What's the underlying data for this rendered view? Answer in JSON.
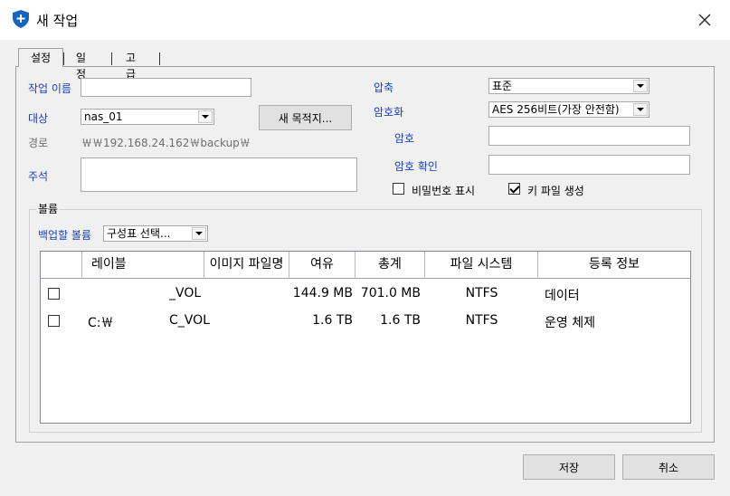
{
  "window": {
    "title": "새 작업"
  },
  "tabs": [
    "설정",
    "일정",
    "고급"
  ],
  "settings": {
    "job_name_label": "작업 이름",
    "job_name_value": "",
    "target_label": "대상",
    "target_value": "nas_01",
    "new_destination_label": "새 목적지...",
    "path_label": "경로",
    "path_value": "￦￦192.168.24.162￦backup￦",
    "comment_label": "주석",
    "comment_value": "",
    "compression_label": "압축",
    "compression_value": "표준",
    "encryption_label": "암호화",
    "encryption_value": "AES 256비트(가장 안전함)",
    "password_label": "암호",
    "password_value": "",
    "confirm_password_label": "암호 확인",
    "confirm_password_value": "",
    "show_password_label": "비밀번호 표시",
    "show_password_checked": false,
    "keyfile_label": "키 파일 생성",
    "keyfile_checked": true
  },
  "volumes": {
    "group_title": "볼륨",
    "backup_volume_label": "백업할 볼륨",
    "backup_volume_value": "구성표 선택...",
    "columns": [
      "레이블",
      "이미지 파일명",
      "여유",
      "총계",
      "파일 시스템",
      "등록 정보"
    ],
    "rows": [
      {
        "label": "",
        "image_name": "_VOL",
        "free": "144.9 MB",
        "total": "701.0 MB",
        "fs": "NTFS",
        "info": "데이터",
        "checked": false
      },
      {
        "label": "C:￦",
        "image_name": "C_VOL",
        "free": "1.6 TB",
        "total": "1.6 TB",
        "fs": "NTFS",
        "info": "운영 체제",
        "checked": false
      }
    ]
  },
  "footer": {
    "save_label": "저장",
    "cancel_label": "취소"
  },
  "colors": {
    "accent_label": "#1a3fbf",
    "shield": "#1565c0"
  }
}
